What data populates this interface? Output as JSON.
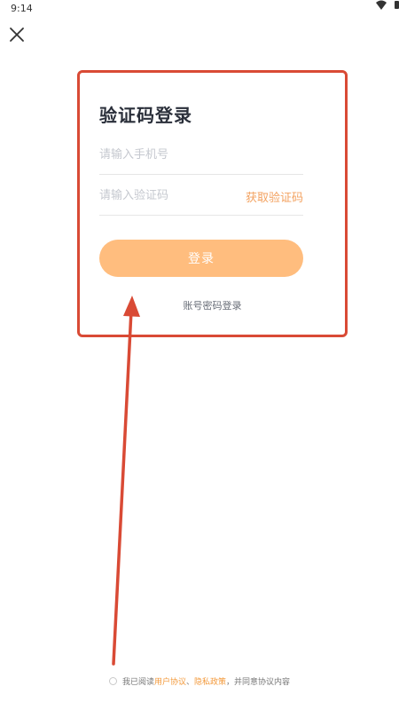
{
  "status_bar": {
    "time": "9:14",
    "wifi_icon": "wifi-icon",
    "battery_icon": "battery-icon"
  },
  "header": {
    "close_icon": "close-icon"
  },
  "login": {
    "title": "验证码登录",
    "phone_placeholder": "请输入手机号",
    "code_placeholder": "请输入验证码",
    "get_code_label": "获取验证码",
    "login_button_label": "登录",
    "password_login_label": "账号密码登录"
  },
  "agreement": {
    "prefix": "我已阅读",
    "user_agreement": "用户协议",
    "separator": "、",
    "privacy_policy": "隐私政策",
    "suffix": "，并同意协议内容"
  },
  "colors": {
    "accent": "#ffbd7e",
    "link": "#f39a3c",
    "annotation": "#d94a35"
  }
}
